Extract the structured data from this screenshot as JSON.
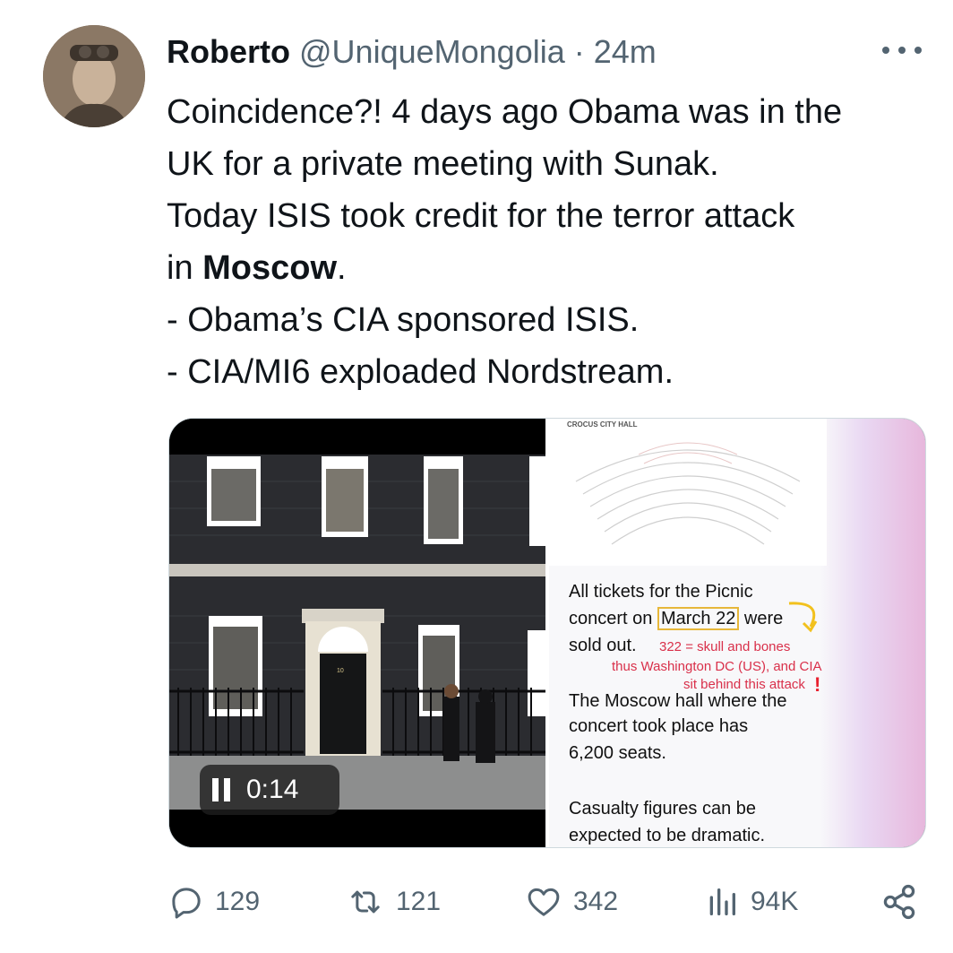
{
  "tweet": {
    "author_name": "Roberto",
    "handle": "@UniqueMongolia",
    "separator": "·",
    "time": "24m",
    "lines": [
      {
        "pre": "Coincidence?! 4 days ago Obama was in the"
      },
      {
        "pre": "UK for a private meeting with Sunak."
      },
      {
        "pre": "Today ISIS took credit for the terror attack"
      },
      {
        "pre": "in ",
        "bold": "Moscow",
        "post": "."
      },
      {
        "pre": "- Obama’s CIA sponsored ISIS."
      },
      {
        "pre": "- CIA/MI6 exploaded Nordstream."
      }
    ]
  },
  "media": {
    "video_time": "0:14",
    "door_number": "10",
    "doc_header": "CROCUS CITY HALL",
    "doc_text": {
      "l1": "All tickets for the Picnic",
      "l2_pre": "concert on ",
      "l2_highlight": "March 22",
      "l2_post": " were",
      "l3": "sold out.",
      "l4": "The Moscow hall where the",
      "l5": "concert took place has",
      "l6": "6,200 seats.",
      "l7": "Casualty figures can be",
      "l8": "expected to be dramatic."
    },
    "annotation": {
      "a1": "322 = skull and bones",
      "a2": "thus Washington DC (US), and CIA",
      "a3": "sit behind this attack",
      "mark": "!"
    }
  },
  "actions": {
    "replies": "129",
    "reposts": "121",
    "likes": "342",
    "views": "94K"
  }
}
